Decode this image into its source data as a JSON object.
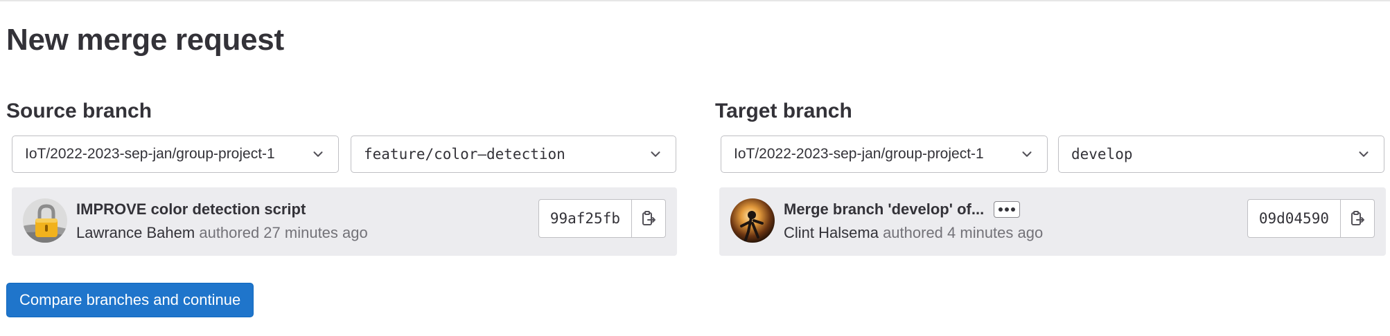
{
  "page": {
    "title": "New merge request"
  },
  "source": {
    "heading": "Source branch",
    "project": "IoT/2022-2023-sep-jan/group-project-1",
    "branch": "feature/color–detection",
    "commit": {
      "title": "IMPROVE color detection script",
      "author": "Lawrance Bahem",
      "time": "authored 27 minutes ago",
      "sha": "99af25fb",
      "avatar_icon": "padlock-avatar"
    }
  },
  "target": {
    "heading": "Target branch",
    "project": "IoT/2022-2023-sep-jan/group-project-1",
    "branch": "develop",
    "commit": {
      "title": "Merge branch 'develop' of...",
      "author": "Clint Halsema",
      "time": "authored 4 minutes ago",
      "sha": "09d04590",
      "avatar_icon": "photo-avatar"
    }
  },
  "actions": {
    "compare_label": "Compare branches and continue"
  },
  "icons": {
    "dropdown": "chevron-down-icon",
    "copy": "copy-to-clipboard-icon",
    "more": "ellipsis-icon"
  },
  "colors": {
    "primary": "#1f75cb",
    "card_bg": "#ececef",
    "text": "#333238",
    "muted": "#737278"
  }
}
